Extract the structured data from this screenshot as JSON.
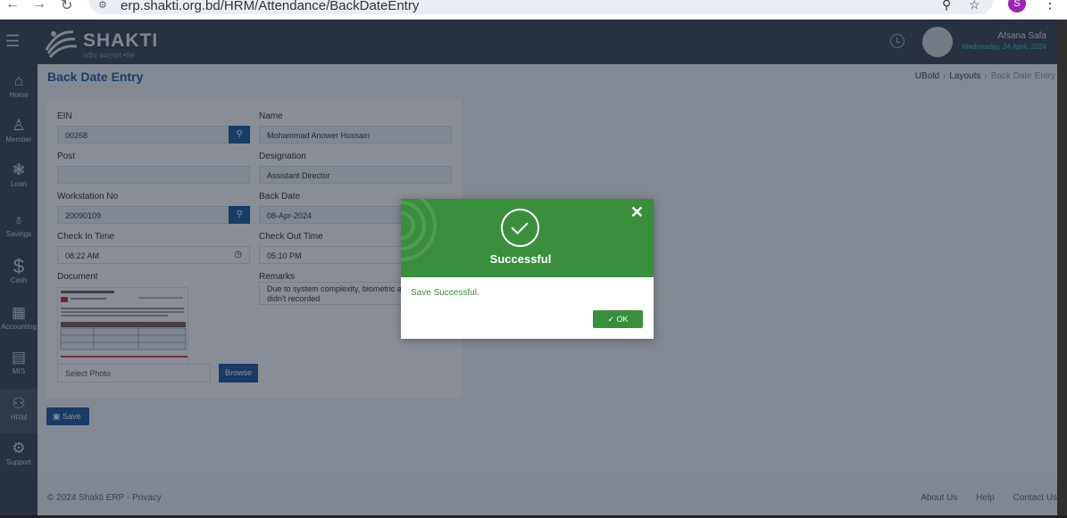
{
  "browser": {
    "url": "erp.shakti.org.bd/HRM/Attendance/BackDateEntry",
    "profile_initial": "S"
  },
  "topbar": {
    "brand": "SHAKTI",
    "brand_sub": "নারীর ক্ষমতায়ন শক্তি",
    "user_name": "Afsana Safa",
    "user_date": "Wednesday, 24 April, 2024"
  },
  "sidebar": {
    "items": [
      {
        "label": "Home",
        "icon": "home-icon"
      },
      {
        "label": "Member",
        "icon": "user-icon"
      },
      {
        "label": "Loan",
        "icon": "handshake-icon"
      },
      {
        "label": "Savings",
        "icon": "money-bag-icon"
      },
      {
        "label": "Cash",
        "icon": "dollar-icon"
      },
      {
        "label": "Accounting",
        "icon": "grid-icon"
      },
      {
        "label": "MIS",
        "icon": "document-icon"
      },
      {
        "label": "HRM",
        "icon": "users-gear-icon"
      },
      {
        "label": "Support",
        "icon": "support-icon"
      }
    ]
  },
  "page": {
    "title": "Back Date Entry",
    "breadcrumb": [
      "UBold",
      "Layouts",
      "Back Date Entry"
    ]
  },
  "form": {
    "ein_label": "EIN",
    "ein_value": "00268",
    "name_label": "Name",
    "name_value": "Mohammad  Anower  Hossain",
    "post_label": "Post",
    "post_value": "",
    "designation_label": "Designation",
    "designation_value": "Assistant Director",
    "workstation_label": "Workstation No",
    "workstation_value": "20090109",
    "backdate_label": "Back Date",
    "backdate_value": "08-Apr-2024",
    "checkin_label": "Check In Time",
    "checkin_value": "08:22 AM",
    "checkout_label": "Check Out Time",
    "checkout_value": "05:10 PM",
    "document_label": "Document",
    "remarks_label": "Remarks",
    "remarks_value": "Due to system complexity, biometric attendance didn't recorded",
    "photo_placeholder": "Select Photo",
    "browse_label": "Browse",
    "save_label": "Save"
  },
  "footer": {
    "copyright": "© 2024 Shakti ERP - Privacy",
    "links": [
      "About Us",
      "Help",
      "Contact Us"
    ]
  },
  "modal": {
    "title": "Successful",
    "message": "Save Successful.",
    "ok_label": "OK",
    "accent": "#3a8f3c"
  }
}
